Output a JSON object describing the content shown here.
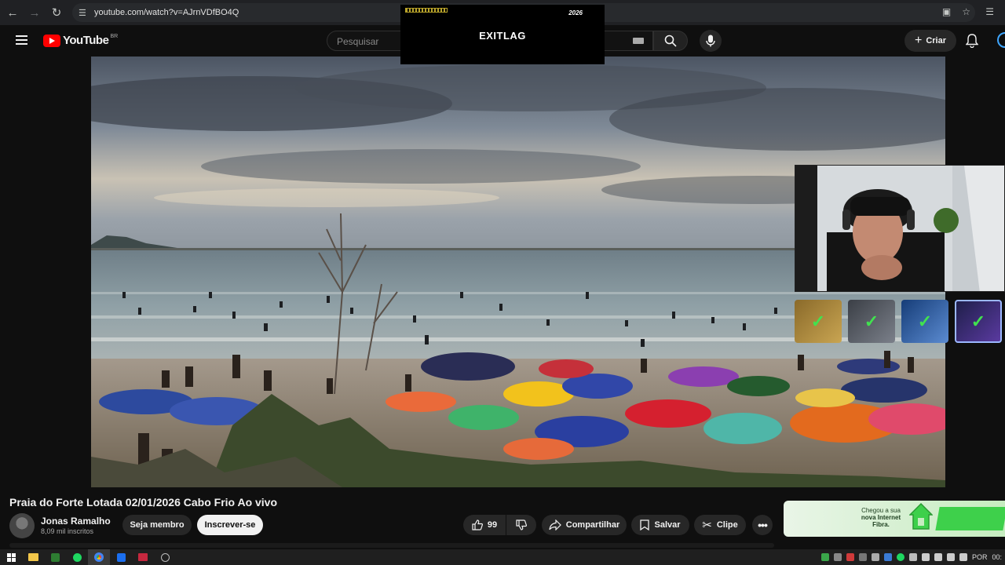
{
  "browser": {
    "url": "youtube.com/watch?v=AJrnVDfBO4Q"
  },
  "youtube": {
    "logo_text": "YouTube",
    "region": "BR",
    "search_placeholder": "Pesquisar",
    "create_label": "Criar"
  },
  "overlay_ad": {
    "brand": "EXITLAG",
    "tag": "2026"
  },
  "video": {
    "title": "Praia do Forte Lotada 02/01/2026 Cabo Frio Ao vivo"
  },
  "channel": {
    "name": "Jonas Ramalho",
    "subscribers": "8,09 mil inscritos",
    "member_label": "Seja membro",
    "subscribe_label": "Inscrever-se"
  },
  "actions": {
    "likes": "99",
    "share_label": "Compartilhar",
    "save_label": "Salvar",
    "clip_label": "Clipe"
  },
  "side_ad": {
    "line1": "Chegou a sua",
    "line2": "nova Internet",
    "line3": "Fibra."
  },
  "taskbar": {
    "language": "POR",
    "clock": "00:"
  },
  "colors": {
    "accent_red": "#ff0000",
    "check_green": "#41e24f"
  }
}
